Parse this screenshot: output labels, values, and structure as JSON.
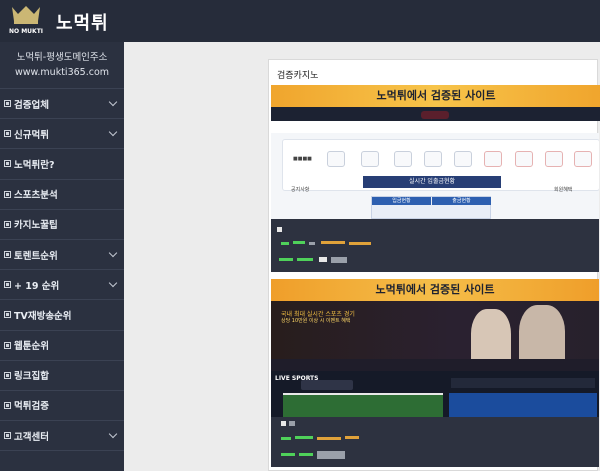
{
  "header": {
    "logo_text": "NO MUKTI",
    "brand": "노먹튀"
  },
  "sidebar": {
    "tagline": "노먹튀-평생도메인주소",
    "domain": "www.mukti365.com",
    "items": [
      {
        "label": "검증업체",
        "has_chevron": true
      },
      {
        "label": "신규먹튀",
        "has_chevron": true
      },
      {
        "label": "노먹튀란?",
        "has_chevron": false
      },
      {
        "label": "스포츠분석",
        "has_chevron": false
      },
      {
        "label": "카지노꿀팁",
        "has_chevron": false
      },
      {
        "label": "토렌트순위",
        "has_chevron": true
      },
      {
        "label": "+ 19 순위",
        "has_chevron": true
      },
      {
        "label": "TV재방송순위",
        "has_chevron": false
      },
      {
        "label": "웹툰순위",
        "has_chevron": false
      },
      {
        "label": "링크집합",
        "has_chevron": false
      },
      {
        "label": "먹튀검증",
        "has_chevron": false
      },
      {
        "label": "고객센터",
        "has_chevron": true
      }
    ]
  },
  "main": {
    "panel_title": "검증카지노",
    "banner1": "노먹튀에서 검증된 사이트",
    "banner2": "노먹튀에서 검증된 사이트",
    "shot": {
      "notice": "공지사항",
      "live_tab": "실시간 입출금현황",
      "deposit": "입금현황",
      "withdraw": "출금현황",
      "event": "회원혜택"
    },
    "hero_text": "국내 최대 실시간 스포츠 경기",
    "hero_sub": "상당 10만원 이상 시 이벤트 혜택",
    "live_sports": "LIVE SPORTS"
  },
  "colors": {
    "sidebar": "#2b3140",
    "header": "#262c3a",
    "banner": "#f3b23c"
  }
}
